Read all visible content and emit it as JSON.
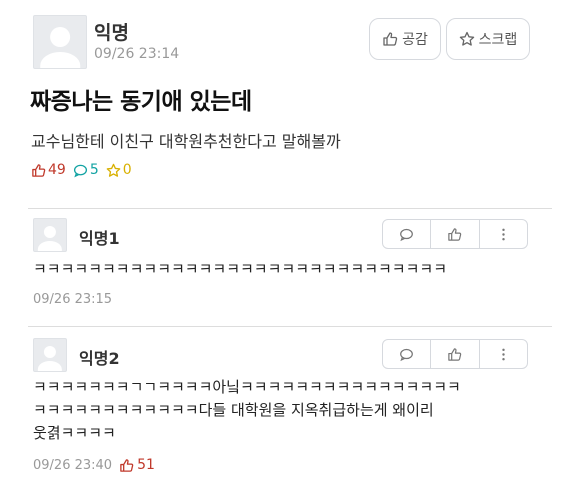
{
  "post": {
    "author": "익명",
    "time": "09/26 23:14",
    "like_button": "공감",
    "scrap_button": "스크랩",
    "title": "짜증나는 동기애 있는데",
    "content": "교수님한테 이친구 대학원추천한다고 말해볼까",
    "stats": {
      "likes": "49",
      "comments": "5",
      "scraps": "0"
    }
  },
  "comments": [
    {
      "author": "익명1",
      "lines": [
        "ㅋㅋㅋㅋㅋㅋㅋㅋㅋㅋㅋㅋㅋㅋㅋㅋㅋㅋㅋㅋㅋㅋㅋㅋㅋㅋㅋㅋㅋㅋ"
      ],
      "time": "09/26 23:15",
      "likes": ""
    },
    {
      "author": "익명2",
      "lines": [
        "ㅋㅋㅋㅋㅋㅋㅋㄱㄱㅋㅋㅋㅋ아닠ㅋㅋㅋㅋㅋㅋㅋㅋㅋㅋㅋㅋㅋㅋㅋㅋ",
        "ㅋㅋㅋㅋㅋㅋㅋㅋㅋㅋㅋㅋ다들 대학원을 지옥취급하는게 왜이리",
        "웃겱ㅋㅋㅋㅋ"
      ],
      "time": "09/26 23:40",
      "likes": "51"
    }
  ],
  "colors": {
    "like": "#c0392b",
    "comment": "#13a3a3",
    "scrap": "#d8b000",
    "muted": "#999999"
  },
  "icons": [
    "thumbs-up-icon",
    "star-icon",
    "speech-bubble-icon",
    "more-vertical-icon"
  ]
}
